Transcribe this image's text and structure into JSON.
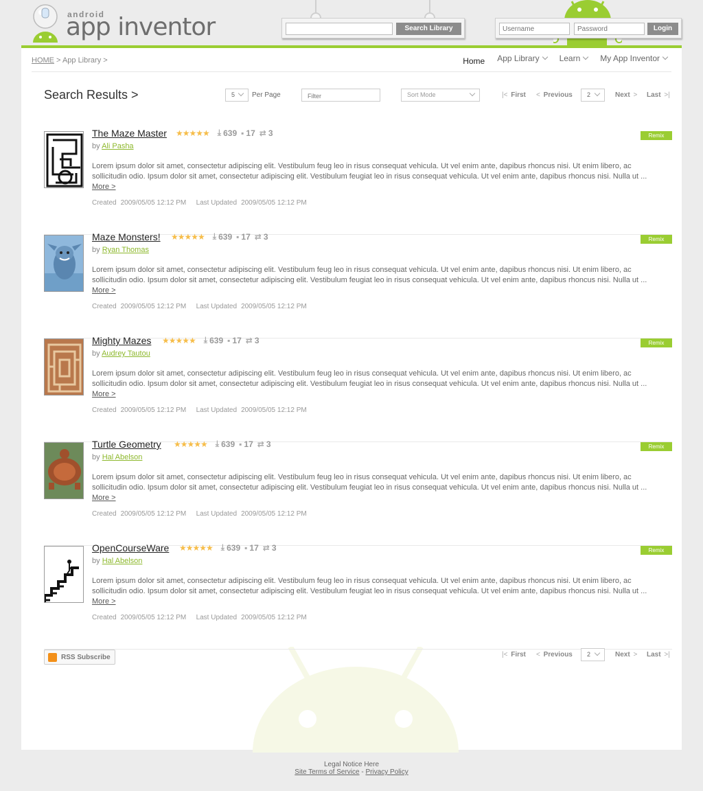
{
  "header": {
    "logo_small": "android",
    "logo_main": "app inventor",
    "search_placeholder": "",
    "search_button": "Search Library",
    "username_placeholder": "Username",
    "password_placeholder": "Password",
    "login_button": "Login"
  },
  "breadcrumb": {
    "home": "HOME",
    "sep1": " > ",
    "section": "App Library",
    "sep2": " >"
  },
  "nav": [
    {
      "label": "Home"
    },
    {
      "label": "App Library"
    },
    {
      "label": "Learn"
    },
    {
      "label": "My App Inventor"
    }
  ],
  "toolbar": {
    "title": "Search Results >",
    "per_page_value": "5",
    "per_page_label": "Per Page",
    "filter_placeholder": "Filter",
    "sort_placeholder": "Sort Mode",
    "first": "First",
    "previous": "Previous",
    "page_value": "2",
    "next": "Next",
    "last": "Last"
  },
  "results": [
    {
      "title": "The Maze Master",
      "by": "by",
      "author": "Ali Pasha",
      "downloads": "639",
      "comments": "17",
      "remixes": "3",
      "description": "Lorem ipsum dolor sit amet, consectetur adipiscing elit. Vestibulum feug leo in risus consequat vehicula. Ut vel enim ante, dapibus rhoncus nisi.  Ut enim libero, ac sollicitudin odio.  Ipsum dolor sit amet, consectetur adipiscing elit. Vestibulum feugiat leo in risus consequat vehicula. Ut vel enim ante, dapibus rhoncus nisi. Nulla ut ...",
      "more": "More >",
      "created_label": "Created",
      "created": "2009/05/05 12:12 PM",
      "updated_label": "Last Updated",
      "updated": "2009/05/05 12:12 PM",
      "remix": "Remix"
    },
    {
      "title": "Maze Monsters!",
      "by": "by",
      "author": "Ryan Thomas",
      "downloads": "639",
      "comments": "17",
      "remixes": "3",
      "description": "Lorem ipsum dolor sit amet, consectetur adipiscing elit. Vestibulum feug leo in risus consequat vehicula. Ut vel enim ante, dapibus rhoncus nisi.  Ut enim libero, ac sollicitudin odio.  Ipsum dolor sit amet, consectetur adipiscing elit. Vestibulum feugiat leo in risus consequat vehicula. Ut vel enim ante, dapibus rhoncus nisi. Nulla ut ...",
      "more": "More >",
      "created_label": "Created",
      "created": "2009/05/05 12:12 PM",
      "updated_label": "Last Updated",
      "updated": "2009/05/05 12:12 PM",
      "remix": "Remix"
    },
    {
      "title": "Mighty Mazes",
      "by": "by",
      "author": "Audrey Tautou",
      "downloads": "639",
      "comments": "17",
      "remixes": "3",
      "description": "Lorem ipsum dolor sit amet, consectetur adipiscing elit. Vestibulum feug leo in risus consequat vehicula. Ut vel enim ante, dapibus rhoncus nisi.  Ut enim libero, ac sollicitudin odio.  Ipsum dolor sit amet, consectetur adipiscing elit. Vestibulum feugiat leo in risus consequat vehicula. Ut vel enim ante, dapibus rhoncus nisi. Nulla ut ...",
      "more": "More >",
      "created_label": "Created",
      "created": "2009/05/05 12:12 PM",
      "updated_label": "Last Updated",
      "updated": "2009/05/05 12:12 PM",
      "remix": "Remix"
    },
    {
      "title": "Turtle Geometry",
      "by": "by",
      "author": "Hal Abelson",
      "downloads": "639",
      "comments": "17",
      "remixes": "3",
      "description": "Lorem ipsum dolor sit amet, consectetur adipiscing elit. Vestibulum feug leo in risus consequat vehicula. Ut vel enim ante, dapibus rhoncus nisi.  Ut enim libero, ac sollicitudin odio.  Ipsum dolor sit amet, consectetur adipiscing elit. Vestibulum feugiat leo in risus consequat vehicula. Ut vel enim ante, dapibus rhoncus nisi. Nulla ut ...",
      "more": "More >",
      "created_label": "Created",
      "created": "2009/05/05 12:12 PM",
      "updated_label": "Last Updated",
      "updated": "2009/05/05 12:12 PM",
      "remix": "Remix"
    },
    {
      "title": "OpenCourseWare",
      "by": "by",
      "author": "Hal Abelson",
      "downloads": "639",
      "comments": "17",
      "remixes": "3",
      "description": "Lorem ipsum dolor sit amet, consectetur adipiscing elit. Vestibulum feug leo in risus consequat vehicula. Ut vel enim ante, dapibus rhoncus nisi.  Ut enim libero, ac sollicitudin odio.  Ipsum dolor sit amet, consectetur adipiscing elit. Vestibulum feugiat leo in risus consequat vehicula. Ut vel enim ante, dapibus rhoncus nisi. Nulla ut ...",
      "more": "More >",
      "created_label": "Created",
      "created": "2009/05/05 12:12 PM",
      "updated_label": "Last Updated",
      "updated": "2009/05/05 12:12 PM",
      "remix": "Remix"
    }
  ],
  "rss_label": "RSS Subscribe",
  "footer": {
    "legal": "Legal Notice Here",
    "terms": "Site Terms of Service",
    "dash": " - ",
    "privacy": "Privacy Policy"
  },
  "icons": {
    "download": "download-icon",
    "comment": "comment-icon",
    "remix": "shuffle-icon",
    "rss": "rss-icon",
    "star": "star-icon"
  },
  "colors": {
    "accent": "#9acd32",
    "star": "#f6bd4a",
    "rss": "#f39019"
  },
  "rating_stars": 5
}
